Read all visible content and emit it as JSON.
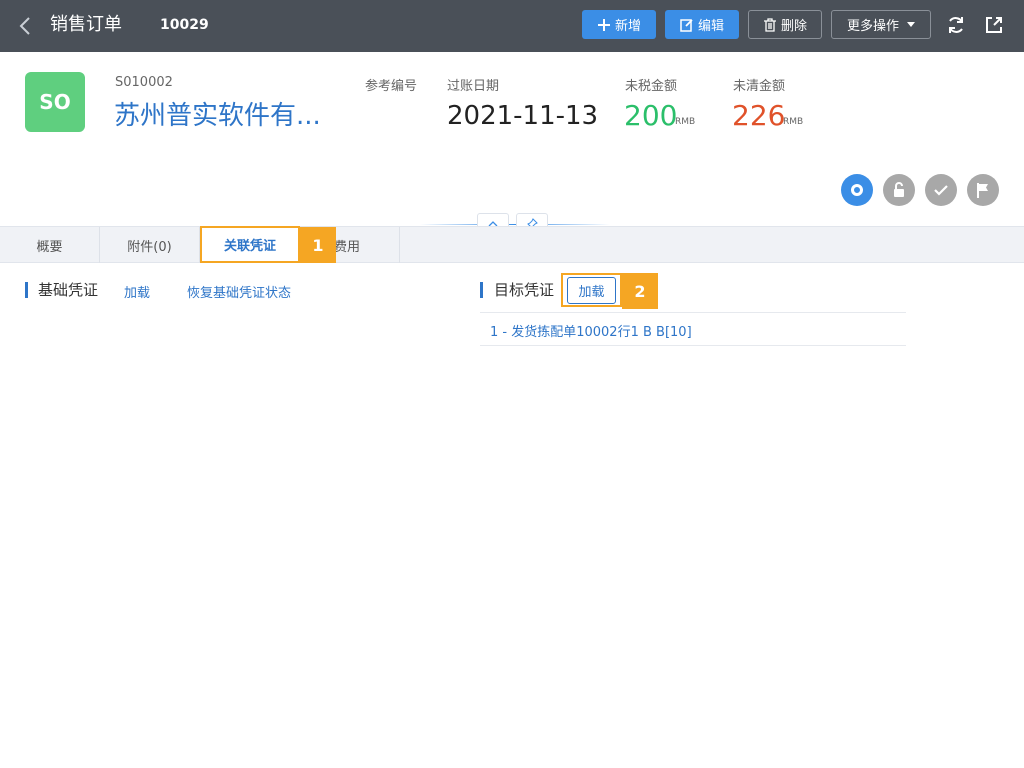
{
  "header": {
    "title": "销售订单",
    "doc_number": "10029",
    "buttons": {
      "add": "新增",
      "edit": "编辑",
      "delete": "删除",
      "more": "更多操作"
    }
  },
  "summary": {
    "avatar_text": "SO",
    "so_code": "S010002",
    "customer": "苏州普实软件有...",
    "ref_label": "参考编号",
    "date_label": "过账日期",
    "date_value": "2021-11-13",
    "net_label": "未税金额",
    "net_value": "200",
    "net_currency": "RMB",
    "open_label": "未清金额",
    "open_value": "226",
    "open_currency": "RMB"
  },
  "tabs": [
    {
      "label": "概要"
    },
    {
      "label": "附件(0)"
    },
    {
      "label": "关联凭证"
    },
    {
      "label": "费用"
    }
  ],
  "callouts": {
    "one": "1",
    "two": "2"
  },
  "base_section": {
    "title": "基础凭证",
    "load": "加载",
    "restore": "恢复基础凭证状态"
  },
  "target_section": {
    "title": "目标凭证",
    "load": "加载",
    "rows": [
      "1 - 发货拣配单10002行1 B B[10]"
    ]
  },
  "colors": {
    "topbar": "#4a5058",
    "primary": "#3b8ee6",
    "link": "#2e75c8",
    "green": "#2bbf6a",
    "red": "#e0522a",
    "highlight": "#f5a623"
  }
}
